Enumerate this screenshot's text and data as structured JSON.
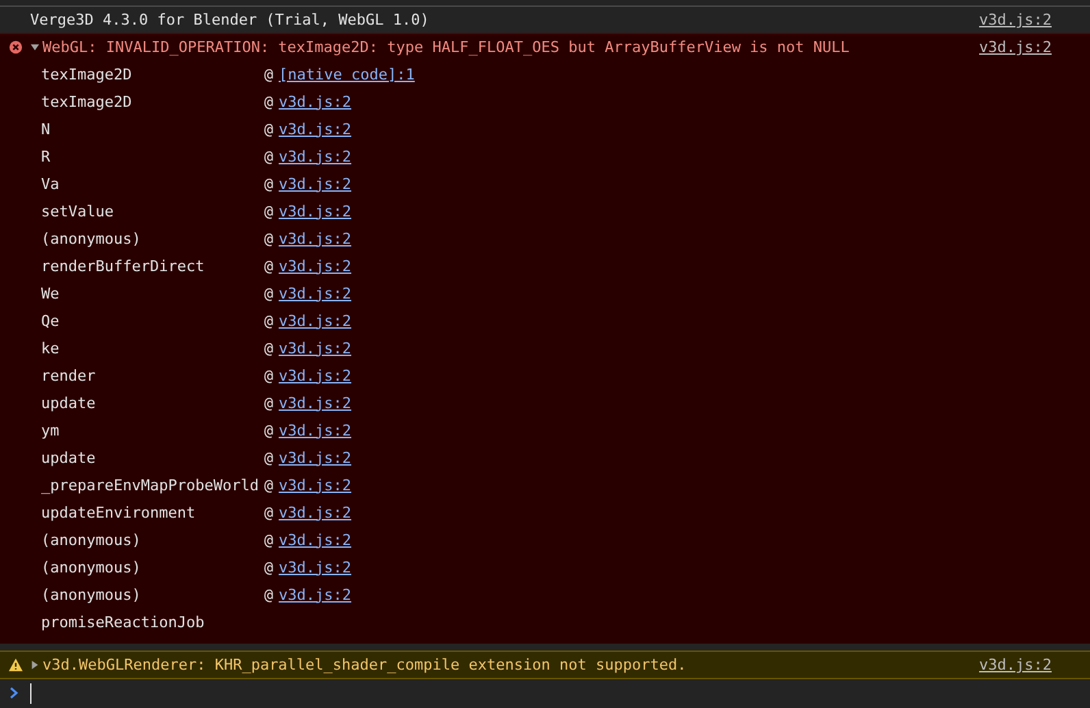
{
  "messages": [
    {
      "kind": "log",
      "text": "Verge3D 4.3.0 for Blender (Trial, WebGL 1.0)",
      "source": "v3d.js:2"
    },
    {
      "kind": "error",
      "expanded": true,
      "text": "WebGL: INVALID_OPERATION: texImage2D: type HALF_FLOAT_OES but ArrayBufferView is not NULL",
      "source": "v3d.js:2",
      "stack": [
        {
          "function": "texImage2D",
          "at": "@",
          "location": "[native code]:1"
        },
        {
          "function": "texImage2D",
          "at": "@",
          "location": "v3d.js:2"
        },
        {
          "function": "N",
          "at": "@",
          "location": "v3d.js:2"
        },
        {
          "function": "R",
          "at": "@",
          "location": "v3d.js:2"
        },
        {
          "function": "Va",
          "at": "@",
          "location": "v3d.js:2"
        },
        {
          "function": "setValue",
          "at": "@",
          "location": "v3d.js:2"
        },
        {
          "function": "(anonymous)",
          "at": "@",
          "location": "v3d.js:2"
        },
        {
          "function": "renderBufferDirect",
          "at": "@",
          "location": "v3d.js:2"
        },
        {
          "function": "We",
          "at": "@",
          "location": "v3d.js:2"
        },
        {
          "function": "Qe",
          "at": "@",
          "location": "v3d.js:2"
        },
        {
          "function": "ke",
          "at": "@",
          "location": "v3d.js:2"
        },
        {
          "function": "render",
          "at": "@",
          "location": "v3d.js:2"
        },
        {
          "function": "update",
          "at": "@",
          "location": "v3d.js:2"
        },
        {
          "function": "ym",
          "at": "@",
          "location": "v3d.js:2"
        },
        {
          "function": "update",
          "at": "@",
          "location": "v3d.js:2"
        },
        {
          "function": "_prepareEnvMapProbeWorld",
          "at": "@",
          "location": "v3d.js:2"
        },
        {
          "function": "updateEnvironment",
          "at": "@",
          "location": "v3d.js:2"
        },
        {
          "function": "(anonymous)",
          "at": "@",
          "location": "v3d.js:2"
        },
        {
          "function": "(anonymous)",
          "at": "@",
          "location": "v3d.js:2"
        },
        {
          "function": "(anonymous)",
          "at": "@",
          "location": "v3d.js:2"
        },
        {
          "function": "promiseReactionJob"
        }
      ]
    },
    {
      "kind": "warning",
      "expanded": false,
      "text": "v3d.WebGLRenderer: KHR_parallel_shader_compile extension not supported.",
      "source": "v3d.js:2"
    }
  ]
}
